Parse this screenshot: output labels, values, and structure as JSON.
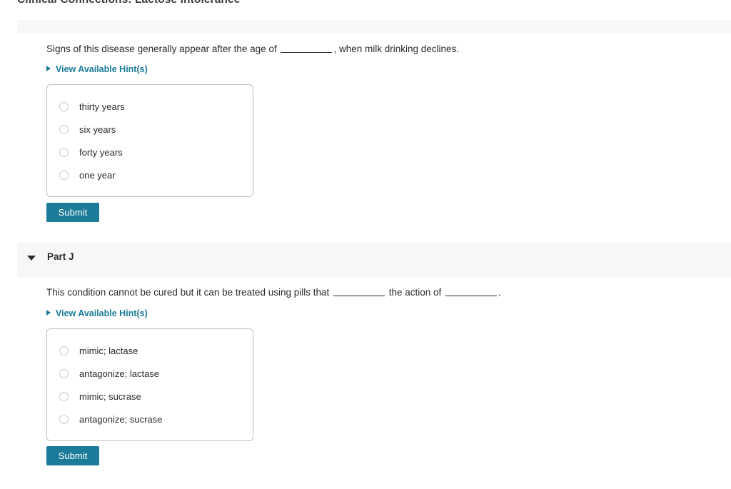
{
  "document": {
    "title": "Clinical Connections: Lactose Intolerance"
  },
  "colors": {
    "accent_teal": "#1b7b99",
    "part_bar_gray": "#f7f7f7",
    "box_border": "#bfbfbf",
    "radio_border": "#cacaca",
    "text": "#2b2b2b"
  },
  "parts": [
    {
      "id": "part-i",
      "label": "",
      "toggle_icon": "caret-down-icon",
      "question": {
        "prefix": "Signs of this disease generally appear after the age of ",
        "blank_1": "__________",
        "suffix": ", when milk drinking declines."
      },
      "hint": {
        "label": "View Available Hint(s)",
        "icon": "caret-right-icon"
      },
      "choices": [
        {
          "label": "thirty years",
          "selected": false
        },
        {
          "label": "six years",
          "selected": false
        },
        {
          "label": "forty years",
          "selected": false
        },
        {
          "label": "one year",
          "selected": false
        }
      ],
      "submit_label": "Submit"
    },
    {
      "id": "part-j",
      "label": "Part J",
      "toggle_icon": "caret-down-icon",
      "question": {
        "prefix": "This condition cannot be cured but it can be treated using pills that ",
        "blank_1": "__________",
        "middle": " the action of ",
        "blank_2": "__________",
        "suffix": "."
      },
      "hint": {
        "label": "View Available Hint(s)",
        "icon": "caret-right-icon"
      },
      "choices": [
        {
          "label": "mimic; lactase",
          "selected": false
        },
        {
          "label": "antagonize; lactase",
          "selected": false
        },
        {
          "label": "mimic; sucrase",
          "selected": false
        },
        {
          "label": "antagonize; sucrase",
          "selected": false
        }
      ],
      "submit_label": "Submit"
    }
  ]
}
